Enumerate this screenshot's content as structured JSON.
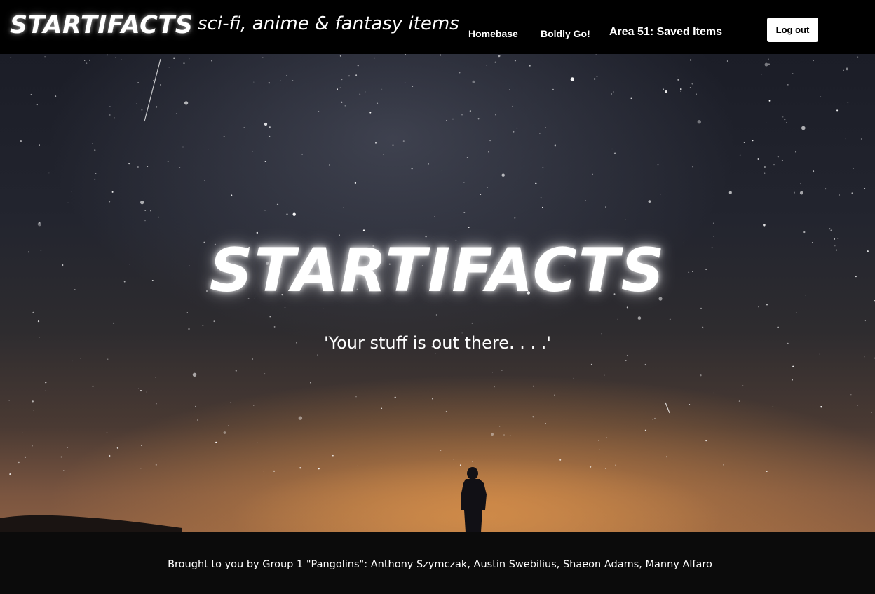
{
  "navbar": {
    "brand": "STARTIFACTS",
    "tagline": "sci-fi, anime & fantasy items",
    "links": [
      "Homebase",
      "Boldly Go!",
      "Area 51: Saved Items"
    ],
    "logout_label": "Log out"
  },
  "hero": {
    "logo_text": "STARTIFACTS",
    "slogan": "'Your stuff is out there. . . .'"
  },
  "footer": {
    "credits": "Brought to you by Group 1 \"Pangolins\": Anthony Szymczak, Austin Swebilius, Shaeon Adams, Manny Alfaro"
  },
  "colors": {
    "navbar_bg": "#000000",
    "footer_bg": "#0b0b0b",
    "text": "#ffffff",
    "sky_glow": "#d68c46"
  }
}
